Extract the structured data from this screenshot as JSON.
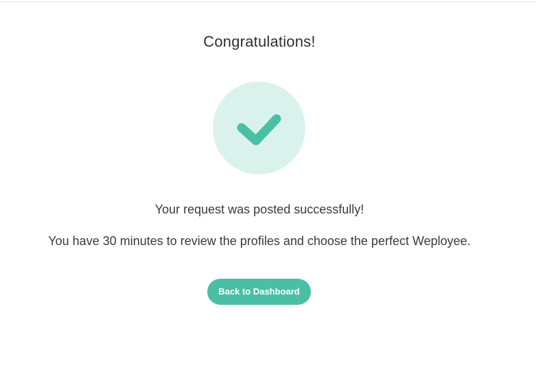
{
  "heading": "Congratulations!",
  "success_icon": "checkmark-icon",
  "messages": {
    "posted": "Your request was posted successfully!",
    "review": "You have 30 minutes to review the profiles and choose the perfect Weployee."
  },
  "actions": {
    "back_label": "Back to Dashboard"
  },
  "colors": {
    "accent": "#4bbfa6",
    "check_bg": "#daf2ec",
    "text": "#333333"
  }
}
